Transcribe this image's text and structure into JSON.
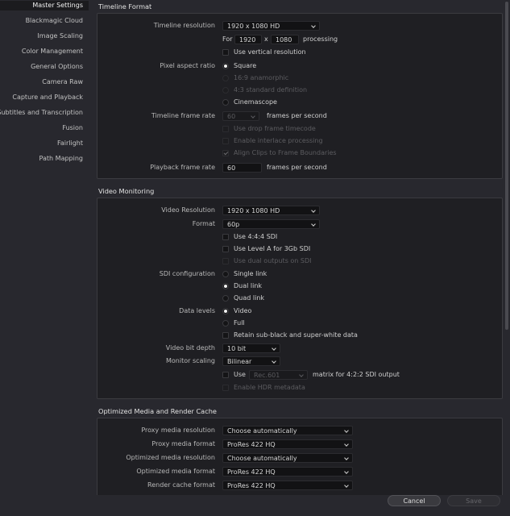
{
  "sidebar": {
    "items": [
      {
        "label": "Master Settings",
        "active": true
      },
      {
        "label": "Blackmagic Cloud"
      },
      {
        "label": "Image Scaling"
      },
      {
        "label": "Color Management"
      },
      {
        "label": "General Options"
      },
      {
        "label": "Camera Raw"
      },
      {
        "label": "Capture and Playback"
      },
      {
        "label": "Subtitles and Transcription"
      },
      {
        "label": "Fusion"
      },
      {
        "label": "Fairlight"
      },
      {
        "label": "Path Mapping"
      }
    ]
  },
  "timeline_format": {
    "title": "Timeline Format",
    "resolution_label": "Timeline resolution",
    "resolution_value": "1920 x 1080 HD",
    "for_label": "For",
    "width_value": "1920",
    "x_label": "x",
    "height_value": "1080",
    "processing_label": "processing",
    "vertical_res_label": "Use vertical resolution",
    "pixel_aspect_label": "Pixel aspect ratio",
    "pixel_aspect_options": [
      "Square",
      "16:9 anamorphic",
      "4:3 standard definition",
      "Cinemascope"
    ],
    "frame_rate_label": "Timeline frame rate",
    "frame_rate_value": "60",
    "fps_label": "frames per second",
    "drop_frame_label": "Use drop frame timecode",
    "interlace_label": "Enable interlace processing",
    "align_clips_label": "Align Clips to Frame Boundaries",
    "playback_rate_label": "Playback frame rate",
    "playback_rate_value": "60",
    "playback_fps_label": "frames per second"
  },
  "video_monitoring": {
    "title": "Video Monitoring",
    "resolution_label": "Video Resolution",
    "resolution_value": "1920 x 1080 HD",
    "format_label": "Format",
    "format_value": "60p",
    "sdi444_label": "Use 4:4:4 SDI",
    "level_a_label": "Use Level A for 3Gb SDI",
    "dual_outputs_label": "Use dual outputs on SDI",
    "sdi_config_label": "SDI configuration",
    "sdi_options": [
      "Single link",
      "Dual link",
      "Quad link"
    ],
    "data_levels_label": "Data levels",
    "data_level_options": [
      "Video",
      "Full"
    ],
    "retain_label": "Retain sub-black and super-white data",
    "bit_depth_label": "Video bit depth",
    "bit_depth_value": "10 bit",
    "scaling_label": "Monitor scaling",
    "scaling_value": "Bilinear",
    "use_label": "Use",
    "matrix_value": "Rec.601",
    "matrix_suffix": "matrix for 4:2:2 SDI output",
    "hdr_label": "Enable HDR metadata"
  },
  "optimized_media": {
    "title": "Optimized Media and Render Cache",
    "rows": [
      {
        "label": "Proxy media resolution",
        "value": "Choose automatically"
      },
      {
        "label": "Proxy media format",
        "value": "ProRes 422 HQ"
      },
      {
        "label": "Optimized media resolution",
        "value": "Choose automatically"
      },
      {
        "label": "Optimized media format",
        "value": "ProRes 422 HQ"
      },
      {
        "label": "Render cache format",
        "value": "ProRes 422 HQ"
      }
    ]
  },
  "footer": {
    "cancel_label": "Cancel",
    "save_label": "Save"
  }
}
